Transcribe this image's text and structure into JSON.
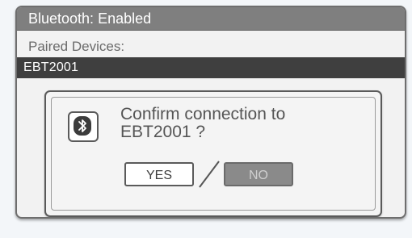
{
  "title_bar": {
    "text": "Bluetooth: Enabled"
  },
  "paired": {
    "label": "Paired Devices:",
    "devices": [
      {
        "name": "EBT2001",
        "selected": true
      }
    ]
  },
  "dialog": {
    "icon": "bluetooth-icon",
    "message_line1": "Confirm connection to",
    "message_line2": "EBT2001 ?",
    "yes_label": "YES",
    "no_label": "NO",
    "selected_button": "YES"
  },
  "colors": {
    "title_bar_bg": "#7f7f7f",
    "selected_row_bg": "#3f3f3f",
    "no_button_bg": "#8a8a8a"
  }
}
